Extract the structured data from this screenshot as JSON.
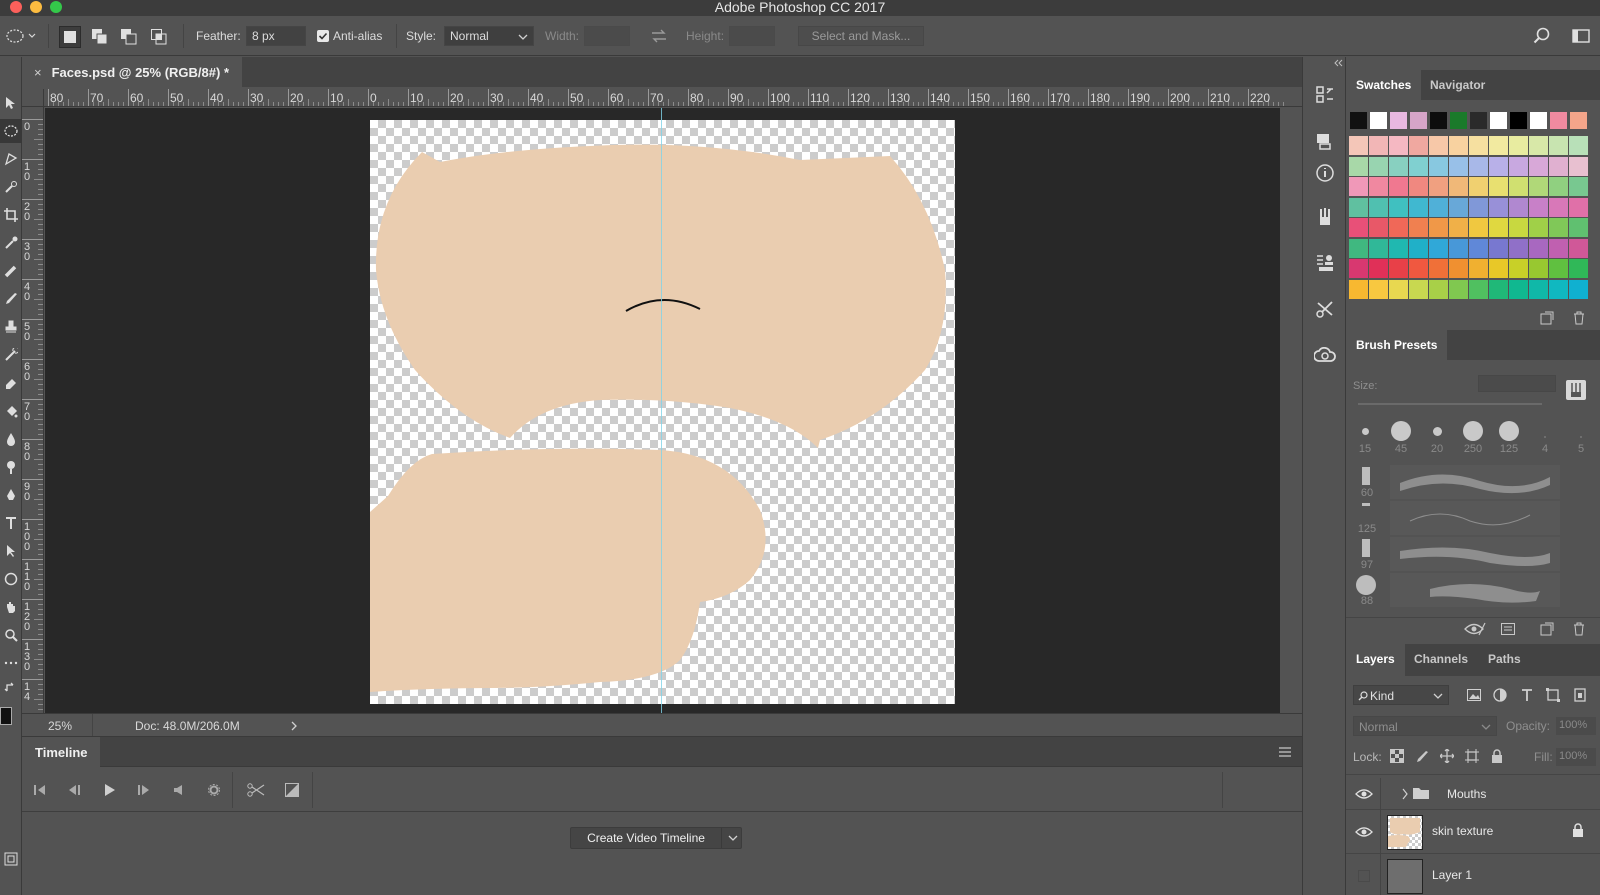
{
  "app": {
    "title": "Adobe Photoshop CC 2017"
  },
  "options_bar": {
    "feather_label": "Feather:",
    "feather_value": "8 px",
    "antialias_label": "Anti-alias",
    "antialias_checked": true,
    "style_label": "Style:",
    "style_value": "Normal",
    "width_label": "Width:",
    "height_label": "Height:",
    "select_mask_label": "Select and Mask..."
  },
  "document": {
    "tab_title": "Faces.psd @ 25% (RGB/8#) *",
    "close_glyph": "×",
    "ruler_h_labels": [
      "80",
      "70",
      "60",
      "50",
      "40",
      "30",
      "20",
      "10",
      "0",
      "10",
      "20",
      "30",
      "40",
      "50",
      "60",
      "70",
      "80",
      "90",
      "100",
      "110",
      "120",
      "130",
      "140",
      "150",
      "160",
      "170",
      "180",
      "190",
      "200",
      "210",
      "220"
    ],
    "ruler_v_labels": [
      "0",
      "1 0",
      "2 0",
      "3 0",
      "4 0",
      "5 0",
      "6 0",
      "7 0",
      "8 0",
      "9 0",
      "1 0 0",
      "1 1 0",
      "1 2 0",
      "1 3 0",
      "1 4"
    ],
    "zoom": "25%",
    "doc_info": "Doc: 48.0M/206.0M"
  },
  "timeline": {
    "title": "Timeline",
    "create_button": "Create Video Timeline"
  },
  "swatches_panel": {
    "tabs": [
      "Swatches",
      "Navigator"
    ],
    "top_row": [
      "#111111",
      "#ffffff",
      "#e8b8e0",
      "#d6a5c8",
      "#0d0d0d",
      "#1a7a2a",
      "#2a2a2a",
      "#ffffff",
      "#000000",
      "#ffffff",
      "#f08aa0",
      "#f4a58a"
    ],
    "grid": [
      [
        "#f4c6b8",
        "#f2b6b6",
        "#f5b8c2",
        "#f0a8a0",
        "#f7c8a8",
        "#f8d2a0",
        "#f6e0a0",
        "#f2eaa0",
        "#e8eca0",
        "#d8e8a8",
        "#c8e4b0",
        "#b8e0b8"
      ],
      [
        "#a8d8a8",
        "#98d4b0",
        "#88d0c0",
        "#80d0d0",
        "#88c8e0",
        "#98c0e8",
        "#a8b8e8",
        "#b8b0e8",
        "#c8a8e0",
        "#d8a8d8",
        "#e0b0d0",
        "#e8c0d0"
      ],
      [
        "#f098b8",
        "#f088a0",
        "#f07890",
        "#f08880",
        "#f0a080",
        "#f0b878",
        "#f0d070",
        "#e8e070",
        "#d0e070",
        "#b0d878",
        "#90d080",
        "#78c890"
      ],
      [
        "#60c0a0",
        "#50c0b0",
        "#40c0c0",
        "#40b8d0",
        "#50b0d8",
        "#68a8d8",
        "#8098d8",
        "#9890d8",
        "#b088d0",
        "#c880c8",
        "#d878b8",
        "#e070a8"
      ],
      [
        "#e85078",
        "#e85868",
        "#f06858",
        "#f08050",
        "#f09848",
        "#f0b048",
        "#f0c840",
        "#e0d840",
        "#c8d840",
        "#a0d048",
        "#80c858",
        "#60c070"
      ],
      [
        "#40b880",
        "#30b898",
        "#20b8b0",
        "#20b0c8",
        "#30a8d8",
        "#4898d8",
        "#6088d8",
        "#7878d0",
        "#9070c8",
        "#a868c0",
        "#c060b0",
        "#d05898"
      ],
      [
        "#d83870",
        "#e03058",
        "#e84048",
        "#f05840",
        "#f07038",
        "#f09030",
        "#f0b030",
        "#e8c828",
        "#c8d028",
        "#98c830",
        "#60c040",
        "#30b858"
      ],
      [
        "#f8b830",
        "#f8c840",
        "#e8d850",
        "#c8d850",
        "#a8d048",
        "#80c850",
        "#50c060",
        "#20b878",
        "#10b890",
        "#10b8a8",
        "#10b8c0",
        "#10b0d0"
      ]
    ]
  },
  "brush_presets_panel": {
    "tab": "Brush Presets",
    "size_label": "Size:",
    "sizes": [
      "15",
      "45",
      "20",
      "250",
      "125",
      "4",
      "5"
    ],
    "stroke_sizes": [
      "60",
      "125",
      "97",
      "88"
    ]
  },
  "layers_panel": {
    "tabs": [
      "Layers",
      "Channels",
      "Paths"
    ],
    "kind_label": "Kind",
    "blend_mode": "Normal",
    "opacity_label": "Opacity:",
    "opacity_value": "100%",
    "lock_label": "Lock:",
    "fill_label": "Fill:",
    "fill_value": "100%",
    "layers": [
      {
        "name": "Mouths",
        "type": "group",
        "visible": true
      },
      {
        "name": "skin texture",
        "type": "pixel",
        "visible": true,
        "locked": true
      },
      {
        "name": "Layer 1",
        "type": "pixel",
        "visible": false
      }
    ]
  },
  "colors": {
    "skin": "#eacdb0",
    "canvas_bg": "#282828",
    "guide": "#7fd3e8"
  }
}
